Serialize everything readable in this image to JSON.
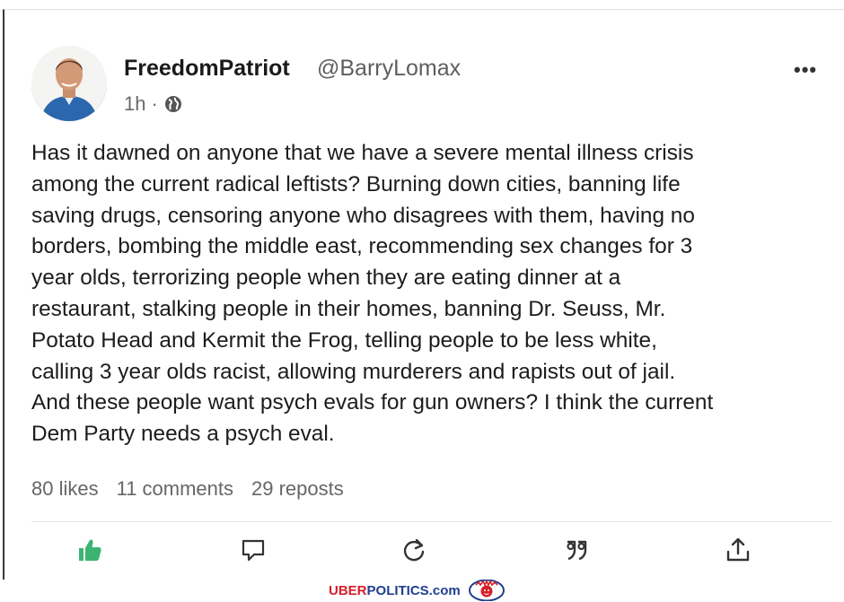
{
  "post": {
    "display_name": "FreedomPatriot",
    "handle": "@BarryLomax",
    "time": "1h",
    "separator": "·",
    "visibility_icon": "globe-icon",
    "more_label": "•••",
    "text": "Has it dawned on anyone that we have a severe mental illness crisis\namong the current radical leftists? Burning down cities, banning life\nsaving drugs, censoring anyone who disagrees with them, having no\nborders, bombing the middle east, recommending sex changes for 3\nyear olds, terrorizing people when they are eating dinner at a\nrestaurant, stalking people in their homes, banning Dr. Seuss, Mr.\nPotato Head and Kermit the Frog, telling people to be less white,\ncalling 3 year olds racist, allowing murderers and rapists out of jail.\nAnd these people want psych evals for gun owners? I think the current\nDem Party needs a psych eval."
  },
  "stats": {
    "likes": "80 likes",
    "comments": "11 comments",
    "reposts": "29 reposts"
  },
  "actions": [
    {
      "icon": "thumbs-up-icon",
      "active": true,
      "color": "#3cb371"
    },
    {
      "icon": "comment-icon",
      "active": false
    },
    {
      "icon": "repost-icon",
      "active": false
    },
    {
      "icon": "quote-icon",
      "active": false
    },
    {
      "icon": "share-icon",
      "active": false
    }
  ],
  "watermark": {
    "brand_red": "UBER",
    "brand_blue": "POLITICS.com",
    "colors": {
      "red": "#d4202a",
      "blue": "#1f3f8f"
    }
  }
}
